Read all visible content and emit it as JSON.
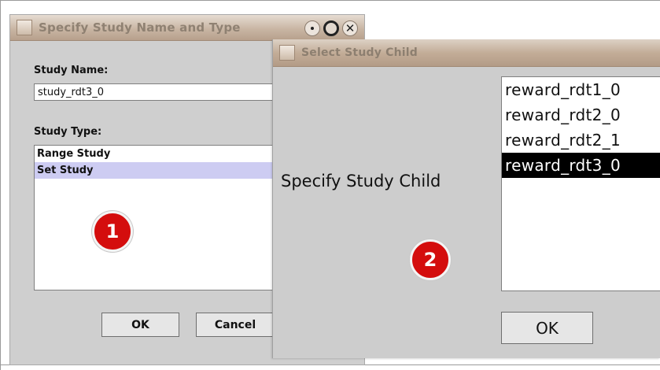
{
  "dialog1": {
    "title": "Specify Study Name and Type",
    "name_label": "Study Name:",
    "name_value": "study_rdt3_0",
    "type_label": "Study Type:",
    "type_options": [
      "Range Study",
      "Set Study"
    ],
    "selected_type": "Set Study",
    "badge": "1",
    "ok_label": "OK",
    "cancel_label": "Cancel",
    "window_buttons": [
      "minimize-icon",
      "maximize-icon",
      "close-icon"
    ],
    "close_glyph": "✕"
  },
  "dialog2": {
    "title": "Select Study Child",
    "prompt": "Specify Study Child",
    "children": [
      "reward_rdt1_0",
      "reward_rdt2_0",
      "reward_rdt2_1",
      "reward_rdt3_0"
    ],
    "selected_child": "reward_rdt3_0",
    "badge": "2",
    "ok_label": "OK"
  },
  "colors": {
    "badge": "#d40d0d",
    "selection_blue": "#cdccf2",
    "selection_black": "#000000"
  }
}
